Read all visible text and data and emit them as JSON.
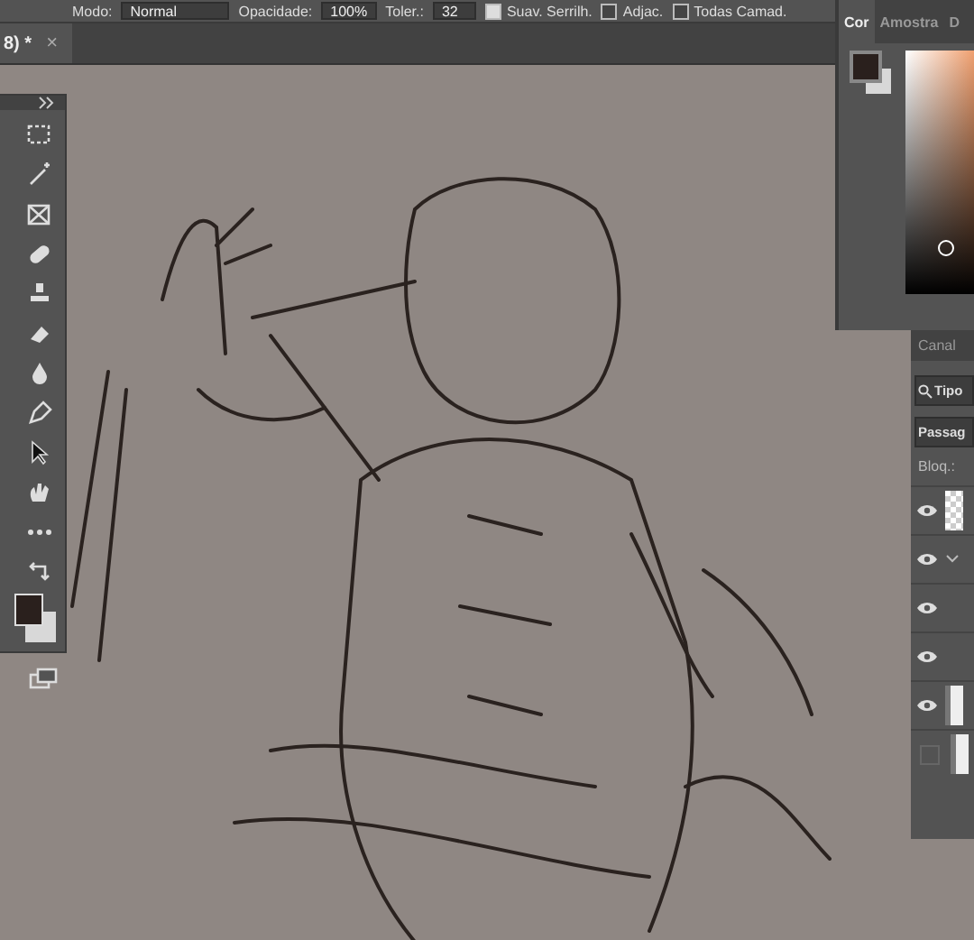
{
  "options_bar": {
    "mode_label": "Modo:",
    "mode": "Normal",
    "opacity_label": "Opacidade:",
    "opacity": "100%",
    "tolerance_label": "Toler.:",
    "tolerance": "32",
    "options": [
      {
        "label": "Suav. Serrilh.",
        "checked": true
      },
      {
        "label": "Adjac.",
        "checked": false
      },
      {
        "label": "Todas Camad.",
        "checked": false
      }
    ]
  },
  "document_tab": {
    "title": "8) *",
    "close": "×"
  },
  "color_panel": {
    "tabs": [
      {
        "label": "Cor",
        "selected": true
      },
      {
        "label": "Amostra",
        "selected": false
      },
      {
        "label": "D",
        "selected": false
      }
    ]
  },
  "layers_panel": {
    "tab": "Canal",
    "search": "Tipo",
    "blend_mode": "Passag",
    "lock_label": "Bloq.:",
    "layers": [
      {
        "kind": "transparent",
        "visible": true
      },
      {
        "kind": "group",
        "visible": true,
        "expanded": true
      },
      {
        "kind": "plain",
        "visible": true
      },
      {
        "kind": "plain",
        "visible": true
      },
      {
        "kind": "art",
        "visible": true
      },
      {
        "kind": "art",
        "visible": false
      }
    ]
  }
}
